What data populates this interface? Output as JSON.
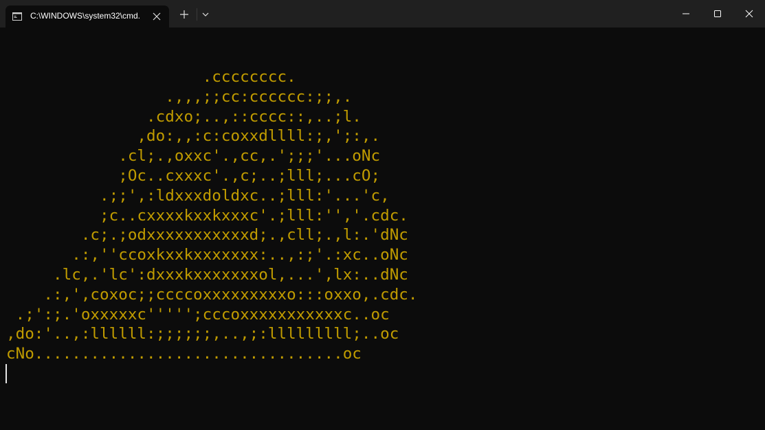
{
  "tab": {
    "title": "C:\\WINDOWS\\system32\\cmd.",
    "icon": "command-prompt-icon"
  },
  "window_controls": [
    "minimize-icon",
    "maximize-icon",
    "close-icon"
  ],
  "terminal": {
    "text_color": "#c19c00",
    "background": "#0c0c0c",
    "lines": [
      "                     .cccccccc.",
      "                 .,,,;;cc:cccccc:;;,.",
      "               .cdxo;..,::cccc::,..;l.",
      "              ,do:,,:c:coxxdllll:;,';:,.",
      "            .cl;.,oxxc'.,cc,.';;;'...oNc",
      "            ;Oc..cxxxc'.,c;..;lll;...cO;",
      "          .;;',:ldxxxdoldxc..;lll:'...'c,",
      "          ;c..cxxxxkxxkxxxc'.;lll:'','.cdc.",
      "        .c;.;odxxxxxxxxxxxd;.,cll;.,l:.'dNc",
      "       .:,''ccoxkxxkxxxxxxx:..,:;'.:xc..oNc",
      "     .lc,.'lc':dxxxkxxxxxxxol,...',lx:..dNc",
      "    .:,',coxoc;;ccccoxxxxxxxxxo:::oxxo,.cdc.",
      " .;':;.'oxxxxxc''''';cccoxxxxxxxxxxxc..oc",
      ",do:'..,:llllll:;;;;;;,..,;:lllllllll;..oc",
      "cNo.................................oc"
    ]
  }
}
